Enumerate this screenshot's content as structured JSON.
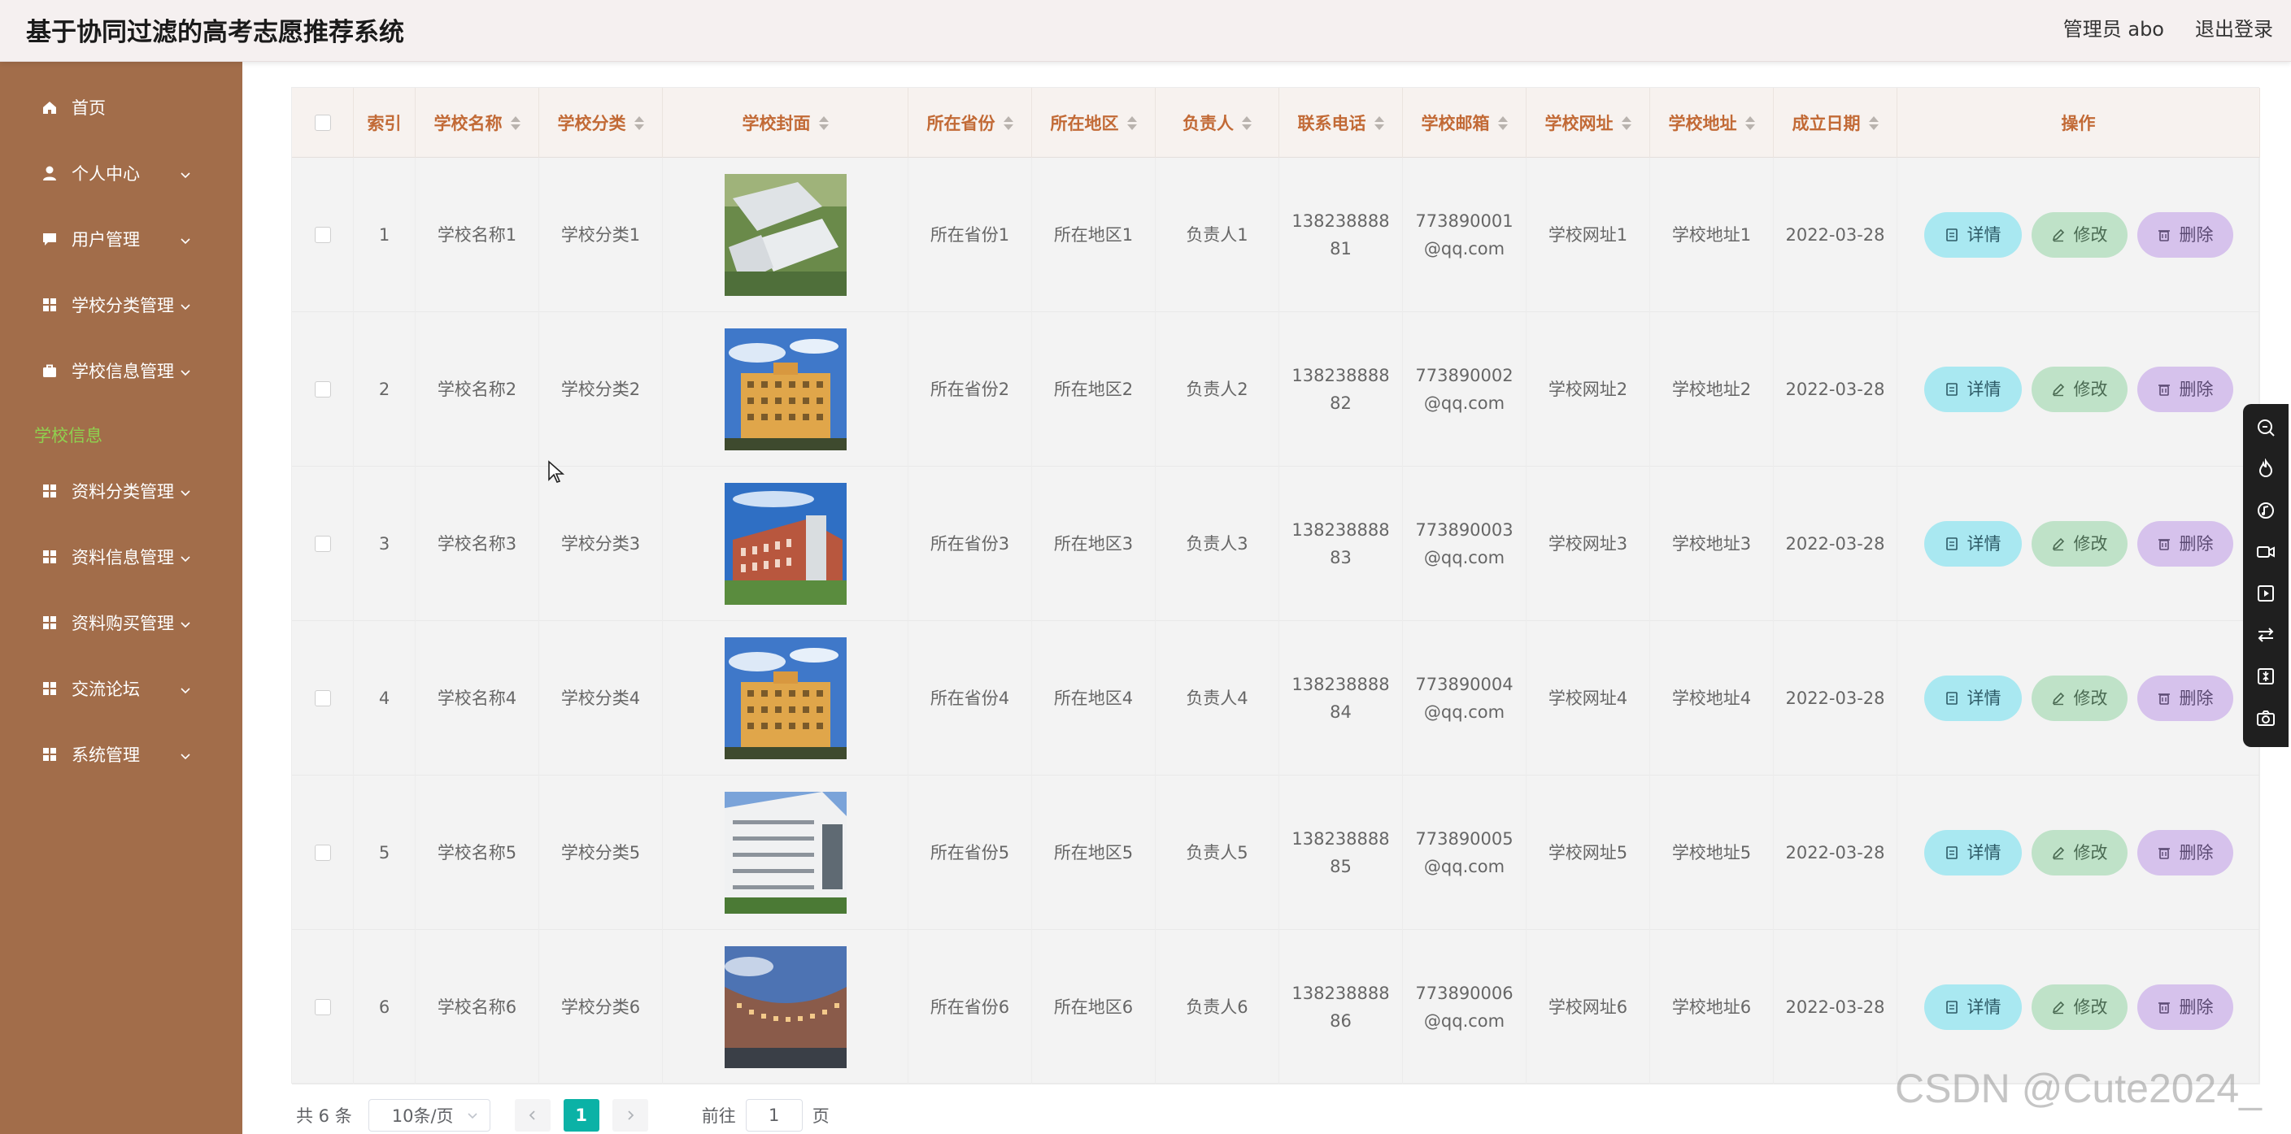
{
  "header": {
    "title": "基于协同过滤的高考志愿推荐系统",
    "user_label": "管理员 abo",
    "logout_label": "退出登录"
  },
  "sidebar": {
    "items": [
      {
        "label": "首页",
        "icon": "home-icon",
        "has_arrow": false
      },
      {
        "label": "个人中心",
        "icon": "user-icon",
        "has_arrow": true
      },
      {
        "label": "用户管理",
        "icon": "chat-icon",
        "has_arrow": true
      },
      {
        "label": "学校分类管理",
        "icon": "grid-icon",
        "has_arrow": true
      },
      {
        "label": "学校信息管理",
        "icon": "briefcase-icon",
        "has_arrow": true
      },
      {
        "label": "资料分类管理",
        "icon": "grid-icon",
        "has_arrow": true
      },
      {
        "label": "资料信息管理",
        "icon": "grid-icon",
        "has_arrow": true
      },
      {
        "label": "资料购买管理",
        "icon": "grid-icon",
        "has_arrow": true
      },
      {
        "label": "交流论坛",
        "icon": "grid-icon",
        "has_arrow": true
      },
      {
        "label": "系统管理",
        "icon": "grid-icon",
        "has_arrow": true
      }
    ],
    "active_submenu": "学校信息"
  },
  "table": {
    "headers": [
      "索引",
      "学校名称",
      "学校分类",
      "学校封面",
      "所在省份",
      "所在地区",
      "负责人",
      "联系电话",
      "学校邮箱",
      "学校网址",
      "学校地址",
      "成立日期",
      "操作"
    ],
    "rows": [
      {
        "index": "1",
        "name": "学校名称1",
        "category": "学校分类1",
        "cover": "campus-aerial",
        "province": "所在省份1",
        "region": "所在地区1",
        "person": "负责人1",
        "phone": [
          "138238888",
          "81"
        ],
        "email": [
          "773890001",
          "@qq.com"
        ],
        "website": "学校网址1",
        "address": "学校地址1",
        "date": "2022-03-28"
      },
      {
        "index": "2",
        "name": "学校名称2",
        "category": "学校分类2",
        "cover": "dorm-building-blue-sky",
        "province": "所在省份2",
        "region": "所在地区2",
        "person": "负责人2",
        "phone": [
          "138238888",
          "82"
        ],
        "email": [
          "773890002",
          "@qq.com"
        ],
        "website": "学校网址2",
        "address": "学校地址2",
        "date": "2022-03-28"
      },
      {
        "index": "3",
        "name": "学校名称3",
        "category": "学校分类3",
        "cover": "red-brick-building",
        "province": "所在省份3",
        "region": "所在地区3",
        "person": "负责人3",
        "phone": [
          "138238888",
          "83"
        ],
        "email": [
          "773890003",
          "@qq.com"
        ],
        "website": "学校网址3",
        "address": "学校地址3",
        "date": "2022-03-28"
      },
      {
        "index": "4",
        "name": "学校名称4",
        "category": "学校分类4",
        "cover": "dorm-building-blue-sky",
        "province": "所在省份4",
        "region": "所在地区4",
        "person": "负责人4",
        "phone": [
          "138238888",
          "84"
        ],
        "email": [
          "773890004",
          "@qq.com"
        ],
        "website": "学校网址4",
        "address": "学校地址4",
        "date": "2022-03-28"
      },
      {
        "index": "5",
        "name": "学校名称5",
        "category": "学校分类5",
        "cover": "white-building",
        "province": "所在省份5",
        "region": "所在地区5",
        "person": "负责人5",
        "phone": [
          "138238888",
          "85"
        ],
        "email": [
          "773890005",
          "@qq.com"
        ],
        "website": "学校网址5",
        "address": "学校地址5",
        "date": "2022-03-28"
      },
      {
        "index": "6",
        "name": "学校名称6",
        "category": "学校分类6",
        "cover": "curved-building-dusk",
        "province": "所在省份6",
        "region": "所在地区6",
        "person": "负责人6",
        "phone": [
          "138238888",
          "86"
        ],
        "email": [
          "773890006",
          "@qq.com"
        ],
        "website": "学校网址6",
        "address": "学校地址6",
        "date": "2022-03-28"
      }
    ],
    "actions": {
      "detail": "详情",
      "edit": "修改",
      "delete": "删除"
    }
  },
  "pagination": {
    "total": "共 6 条",
    "page_size": "10条/页",
    "current_page": "1",
    "goto_label": "前往",
    "goto_value": "1",
    "page_unit": "页"
  },
  "watermark": "CSDN @Cute2024_",
  "colors": {
    "sidebar_bg": "#a26d4a",
    "header_bg": "#f5f0f0",
    "header_text": "#c26a36",
    "active_submenu": "#8fd14f",
    "btn_detail": "#a9e8f1",
    "btn_edit": "#bfe2c8",
    "btn_delete": "#d6c2ec",
    "pager_active": "#0bb2a6"
  }
}
